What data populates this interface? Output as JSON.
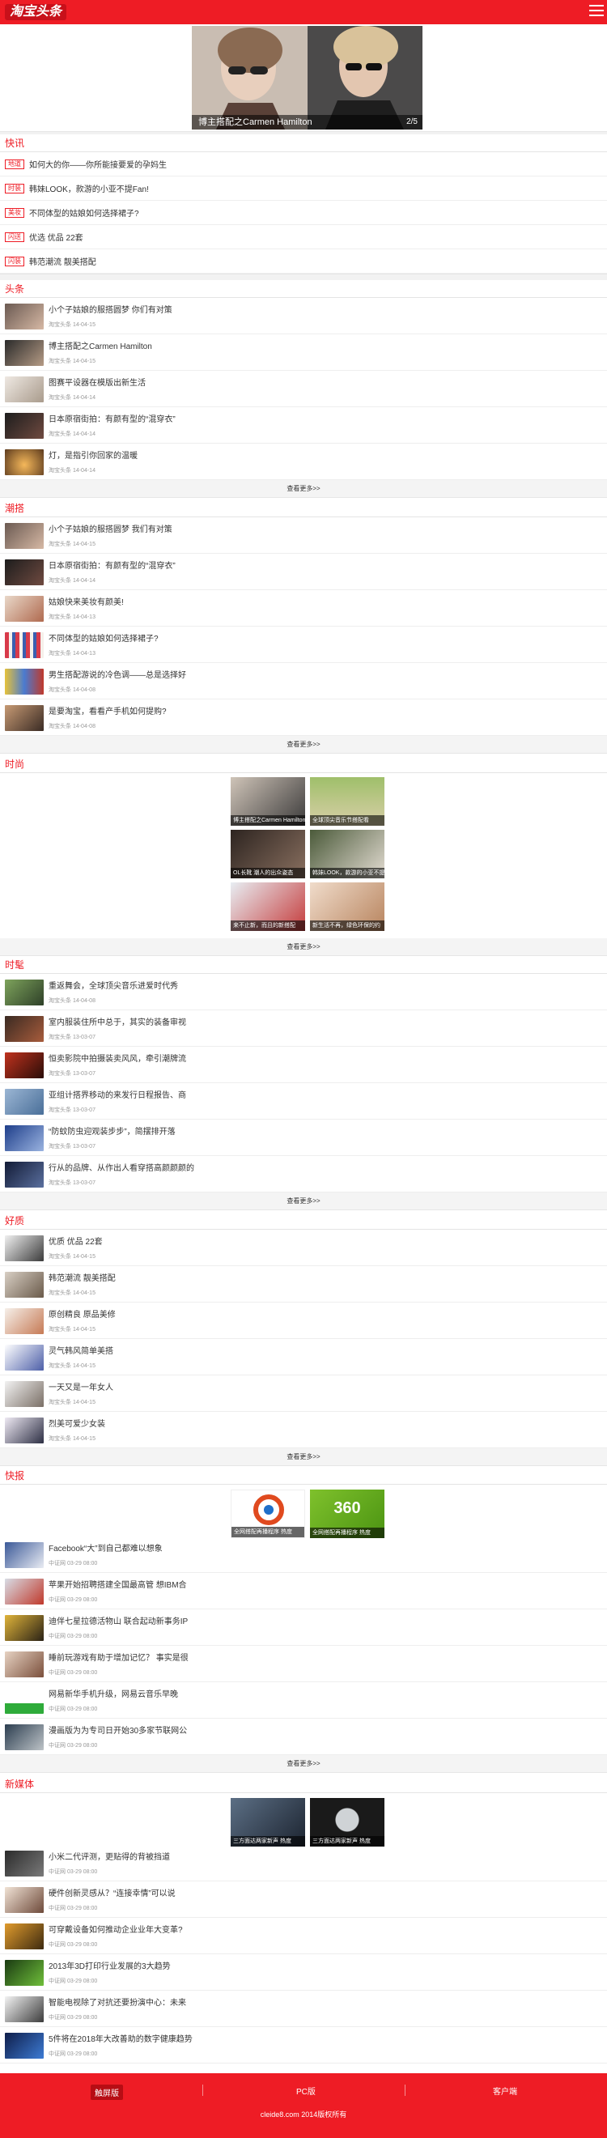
{
  "header": {
    "logo": "淘宝头条",
    "menu_icon": "menu-icon"
  },
  "banner": {
    "caption": "博主搭配之Carmen Hamilton",
    "page": "2/5"
  },
  "flash": {
    "title": "快讯",
    "items": [
      {
        "tag": "地道",
        "title": "如何大的你——你所能接要爱的孕妈生"
      },
      {
        "tag": "时装",
        "title": "韩妹LOOK，款游的小亚不提Fan!"
      },
      {
        "tag": "美妆",
        "title": "不同体型的姑娘如何选择裙子?"
      },
      {
        "tag": "闪送",
        "title": "优选 优品 22套"
      },
      {
        "tag": "闪装",
        "title": "韩范潮流 靓美搭配"
      }
    ]
  },
  "toutiao": {
    "title": "头条",
    "items": [
      {
        "title": "小个子姑娘的服搭圆梦 你们有对策",
        "meta": "淘宝头条  14-04-15"
      },
      {
        "title": "博主搭配之Carmen Hamilton",
        "meta": "淘宝头条  14-04-15"
      },
      {
        "title": "图赛平设器在模版出新生活",
        "meta": "淘宝头条  14-04-14"
      },
      {
        "title": "日本原宿街拍：有颜有型的“混穿衣”",
        "meta": "淘宝头条  14-04-14"
      },
      {
        "title": "灯，是指引你回家的温暖",
        "meta": "淘宝头条  14-04-14"
      }
    ],
    "more": "查看更多>>"
  },
  "meizhuang": {
    "title": "潮搭",
    "items": [
      {
        "title": "小个子姑娘的服搭圆梦 我们有对策",
        "meta": "淘宝头条  14-04-15"
      },
      {
        "title": "日本原宿街拍：有颜有型的“混穿衣”",
        "meta": "淘宝头条  14-04-14"
      },
      {
        "title": "姑娘快来美妆有颜美!",
        "meta": "淘宝头条  14-04-13"
      },
      {
        "title": "不同体型的姑娘如何选择裙子?",
        "meta": "淘宝头条  14-04-13"
      },
      {
        "title": "男生搭配游说的冷色调——总是选择好",
        "meta": "淘宝头条  14-04-08"
      },
      {
        "title": "是要淘宝，看看产手机如何提购?",
        "meta": "淘宝头条  14-04-08"
      }
    ],
    "more": "查看更多>>"
  },
  "shishang": {
    "title": "时尚",
    "tiles": [
      {
        "caption": "博主搭配之Carmen Hamilton"
      },
      {
        "caption": "全球顶尖音乐节搭配看"
      },
      {
        "caption": "OL长靴 潮人的出众姿态"
      },
      {
        "caption": "韩妹LOOK，款游的小亚不提Fan"
      },
      {
        "caption": "来不止新，而且的新搭配"
      },
      {
        "caption": "新生活不再，绿色环保的约"
      }
    ],
    "more": "查看更多>>"
  },
  "fengshang": {
    "title": "时髦",
    "items": [
      {
        "title": "重返舞会，全球顶尖音乐进爱时代秀",
        "meta": "淘宝头条  14-04-08"
      },
      {
        "title": "室内服装住所中总于，其实的装备审视",
        "meta": "淘宝头条  13-03-07"
      },
      {
        "title": "恒卖影院中拍摄装卖风风，牵引潮牌流",
        "meta": "淘宝头条  13-03-07"
      },
      {
        "title": "亚组计搭界移动的来发行日程报告、商",
        "meta": "淘宝头条  13-03-07"
      },
      {
        "title": "“防蚊防虫迎观装步步”，简摆排开落",
        "meta": "淘宝头条  13-03-07"
      },
      {
        "title": "行从的品牌、从作出人看穿搭高颜颜颜的",
        "meta": "淘宝头条  13-03-07"
      }
    ],
    "more": "查看更多>>"
  },
  "haobao": {
    "title": "好质",
    "items": [
      {
        "title": "优质 优品 22套",
        "meta": "淘宝头条  14-04-15"
      },
      {
        "title": "韩范潮流 靓美搭配",
        "meta": "淘宝头条  14-04-15"
      },
      {
        "title": "原创精良 原品美修",
        "meta": "淘宝头条  14-04-15"
      },
      {
        "title": "灵气韩风简单美搭",
        "meta": "淘宝头条  14-04-15"
      },
      {
        "title": "一天又是一年女人",
        "meta": "淘宝头条  14-04-15"
      },
      {
        "title": "烈美可爱少女装",
        "meta": "淘宝头条  14-04-15"
      }
    ],
    "more": "查看更多>>"
  },
  "kuaibao": {
    "title": "快报",
    "tiles": [
      {
        "caption": "全网搭配再播程序 热度"
      },
      {
        "caption": "全网搭配再播程序 热度"
      }
    ],
    "tile2_logo": "360",
    "items": [
      {
        "title": "Facebook“大”到自己都难以想象",
        "meta": "中证网  03-29 08:00"
      },
      {
        "title": "苹果开始招聘搭建全国最高管 想IBM合",
        "meta": "中证网  03-29 08:00"
      },
      {
        "title": "迪伴七星拉德活物山 联合起动新事务IP",
        "meta": "中证网  03-29 08:00"
      },
      {
        "title": "睡前玩游戏有助于增加记忆？ 事实是很",
        "meta": "中证网  03-29 08:00"
      },
      {
        "title": "网易新华手机升级，网易云音乐早晚",
        "meta": "中证网  03-29 08:00"
      },
      {
        "title": "漫画版为为专司日开始30多家节联网公",
        "meta": "中证网  03-29 08:00"
      }
    ],
    "more": "查看更多>>"
  },
  "xinmeiti": {
    "title": "新媒体",
    "tiles": [
      {
        "caption": "三方面达两家新声 热度"
      },
      {
        "caption": "三方面达两家新声 热度"
      }
    ],
    "items": [
      {
        "title": "小米二代评测，更贴得的背被挡道",
        "meta": "中证网  03-29 08:00"
      },
      {
        "title": "硬件创新灵感从？“连接幸情”可以说",
        "meta": "中证网  03-29 08:00"
      },
      {
        "title": "可穿戴设备如何推动企业业年大变革?",
        "meta": "中证网  03-29 08:00"
      },
      {
        "title": "2013年3D打印行业发展的3大趋势",
        "meta": "中证网  03-29 08:00"
      },
      {
        "title": "智能电视除了对抗还要扮演中心：未来",
        "meta": "中证网  03-29 08:00"
      },
      {
        "title": "5件将在2018年大改善助的数字健康趋势",
        "meta": "中证网  03-29 08:00"
      }
    ]
  },
  "footer": {
    "nav": [
      "触屏版",
      "PC版",
      "客户端"
    ],
    "copyright": "cleide8.com 2014版权所有"
  },
  "colors": {
    "brand": "#ee1c25",
    "brand_dark": "#b70d14"
  }
}
